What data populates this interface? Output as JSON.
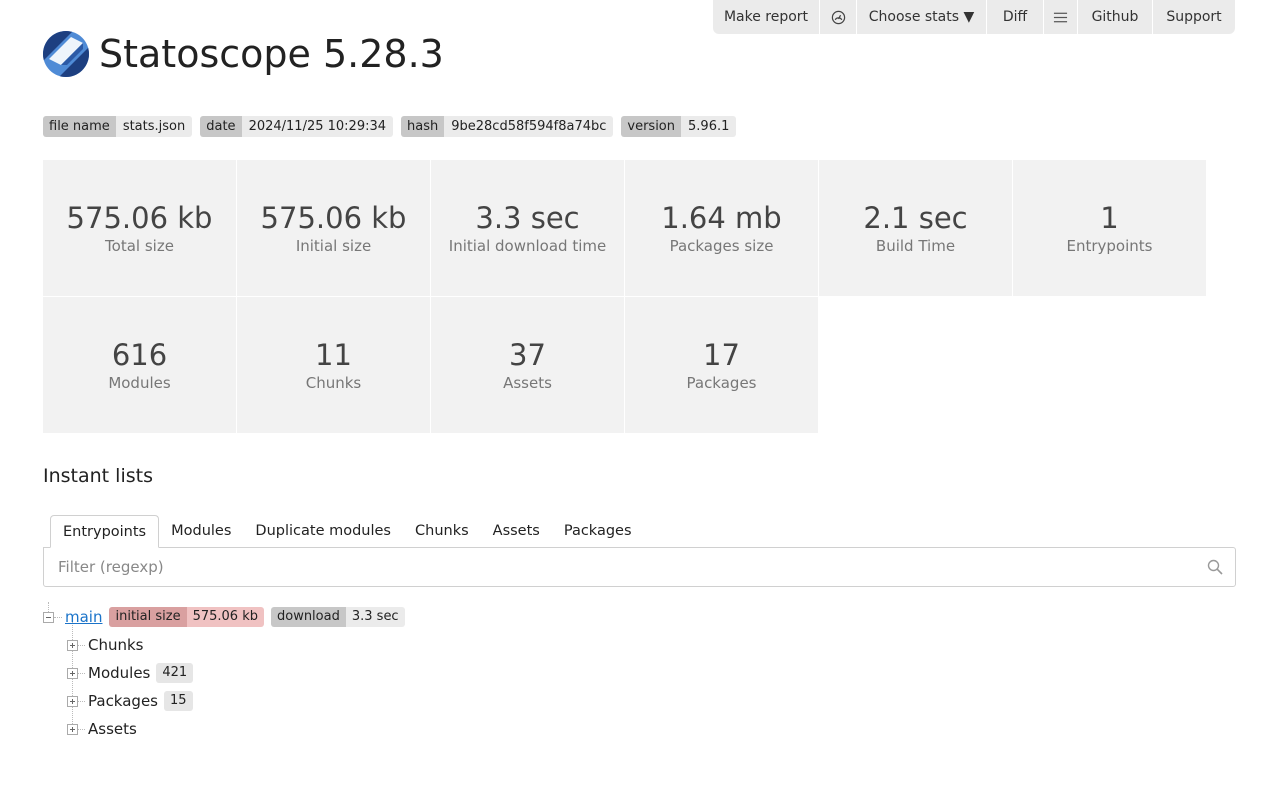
{
  "app": {
    "title": "Statoscope 5.28.3"
  },
  "nav": {
    "make_report": "Make report",
    "choose_stats": "Choose stats ▼",
    "diff": "Diff",
    "github": "Github",
    "support": "Support",
    "icons": {
      "gauge": "dashboard-icon",
      "menu": "hamburger-menu-icon"
    }
  },
  "badges": [
    {
      "key": "file name",
      "value": "stats.json"
    },
    {
      "key": "date",
      "value": "2024/11/25 10:29:34"
    },
    {
      "key": "hash",
      "value": "9be28cd58f594f8a74bc"
    },
    {
      "key": "version",
      "value": "5.96.1"
    }
  ],
  "stats": [
    {
      "value": "575.06 kb",
      "label": "Total size"
    },
    {
      "value": "575.06 kb",
      "label": "Initial size"
    },
    {
      "value": "3.3 sec",
      "label": "Initial download time"
    },
    {
      "value": "1.64 mb",
      "label": "Packages size"
    },
    {
      "value": "2.1 sec",
      "label": "Build Time"
    },
    {
      "value": "1",
      "label": "Entrypoints"
    },
    {
      "value": "616",
      "label": "Modules"
    },
    {
      "value": "11",
      "label": "Chunks"
    },
    {
      "value": "37",
      "label": "Assets"
    },
    {
      "value": "17",
      "label": "Packages"
    }
  ],
  "instant_lists": {
    "title": "Instant lists",
    "tabs": [
      "Entrypoints",
      "Modules",
      "Duplicate modules",
      "Chunks",
      "Assets",
      "Packages"
    ],
    "active_tab": "Entrypoints",
    "filter": {
      "placeholder": "Filter (regexp)",
      "value": ""
    }
  },
  "tree": {
    "root": {
      "name": "main",
      "initial_size": {
        "key": "initial size",
        "value": "575.06 kb"
      },
      "download": {
        "key": "download",
        "value": "3.3 sec"
      }
    },
    "children": [
      {
        "label": "Chunks",
        "count": ""
      },
      {
        "label": "Modules",
        "count": "421"
      },
      {
        "label": "Packages",
        "count": "15"
      },
      {
        "label": "Assets",
        "count": ""
      }
    ]
  },
  "colors": {
    "accent_link": "#1a73c9",
    "stat_tile": "#f2f2f2",
    "badge_key": "#c7c7c7",
    "badge_value": "#ebebeb",
    "size_key": "#d9a0a0",
    "size_value": "#f0c2c2",
    "logo_dark": "#1d3f80",
    "logo_light": "#4f8bd6"
  }
}
